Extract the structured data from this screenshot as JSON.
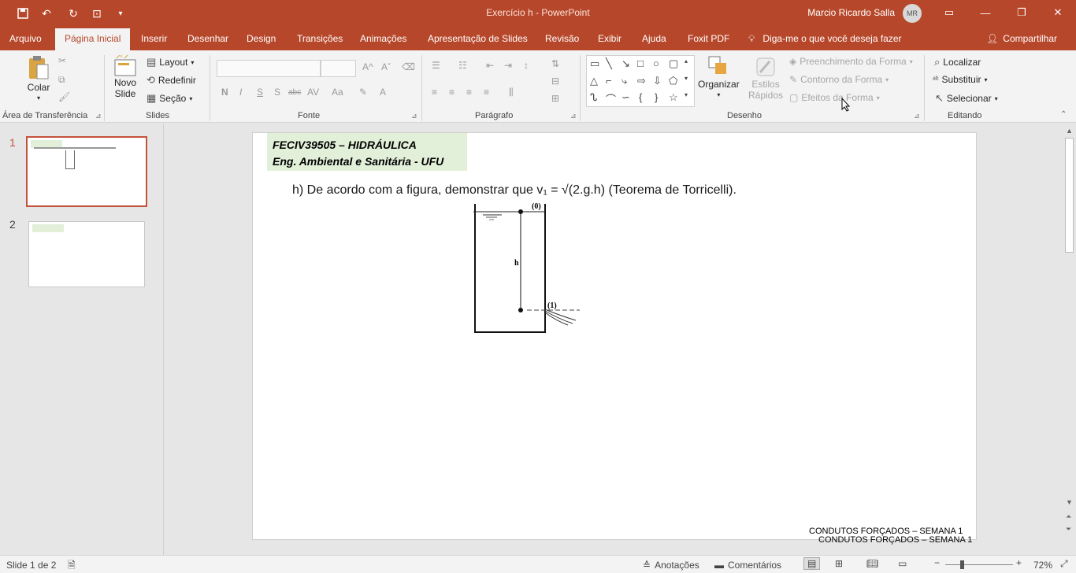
{
  "window": {
    "title": "Exercício h  -  PowerPoint",
    "user": "Marcio Ricardo Salla",
    "user_initials": "MR"
  },
  "quick_access": [
    "save-icon",
    "undo-icon",
    "redo-icon",
    "present-icon",
    "customize-icon"
  ],
  "tabs": [
    {
      "label": "Arquivo"
    },
    {
      "label": "Página Inicial",
      "active": true
    },
    {
      "label": "Inserir"
    },
    {
      "label": "Desenhar"
    },
    {
      "label": "Design"
    },
    {
      "label": "Transições"
    },
    {
      "label": "Animações"
    },
    {
      "label": "Apresentação de Slides"
    },
    {
      "label": "Revisão"
    },
    {
      "label": "Exibir"
    },
    {
      "label": "Ajuda"
    },
    {
      "label": "Foxit PDF"
    }
  ],
  "tellme": "Diga-me o que você deseja fazer",
  "share": "Compartilhar",
  "ribbon": {
    "clipboard": {
      "paste": "Colar",
      "label": "Área de Transferência"
    },
    "slides": {
      "new_slide": "Novo",
      "new_slide2": "Slide",
      "layout": "Layout",
      "reset": "Redefinir",
      "section": "Seção",
      "label": "Slides"
    },
    "font": {
      "label": "Fonte"
    },
    "paragraph": {
      "label": "Parágrafo"
    },
    "drawing": {
      "arrange": "Organizar",
      "quick_styles": "Estilos",
      "quick_styles2": "Rápidos",
      "fill": "Preenchimento da Forma",
      "outline": "Contorno da Forma",
      "effects": "Efeitos da Forma",
      "label": "Desenho"
    },
    "editing": {
      "find": "Localizar",
      "replace": "Substituir",
      "select": "Selecionar",
      "label": "Editando"
    }
  },
  "thumbnails": [
    {
      "number": "1",
      "selected": true
    },
    {
      "number": "2",
      "selected": false
    }
  ],
  "slide": {
    "header_line1": "FECIV39505 – HIDRÁULICA",
    "header_line2": "Eng. Ambiental e Sanitária - UFU",
    "question": "h)  De acordo com a figura, demonstrar que v₁ = √(2.g.h) (Teorema de Torricelli).",
    "figure_labels": {
      "top": "(0)",
      "height": "h",
      "outlet": "(1)"
    },
    "footer1": "CONDUTOS FORÇADOS – SEMANA 1",
    "footer2": "CONDUTOS FORÇADOS – SEMANA 1"
  },
  "status": {
    "slide_info": "Slide 1 de 2",
    "notes": "Anotações",
    "comments": "Comentários",
    "zoom": "72%",
    "zoom_level_percent": 72
  },
  "colors": {
    "accent": "#b7472a",
    "header_fill": "#e2efd9"
  }
}
